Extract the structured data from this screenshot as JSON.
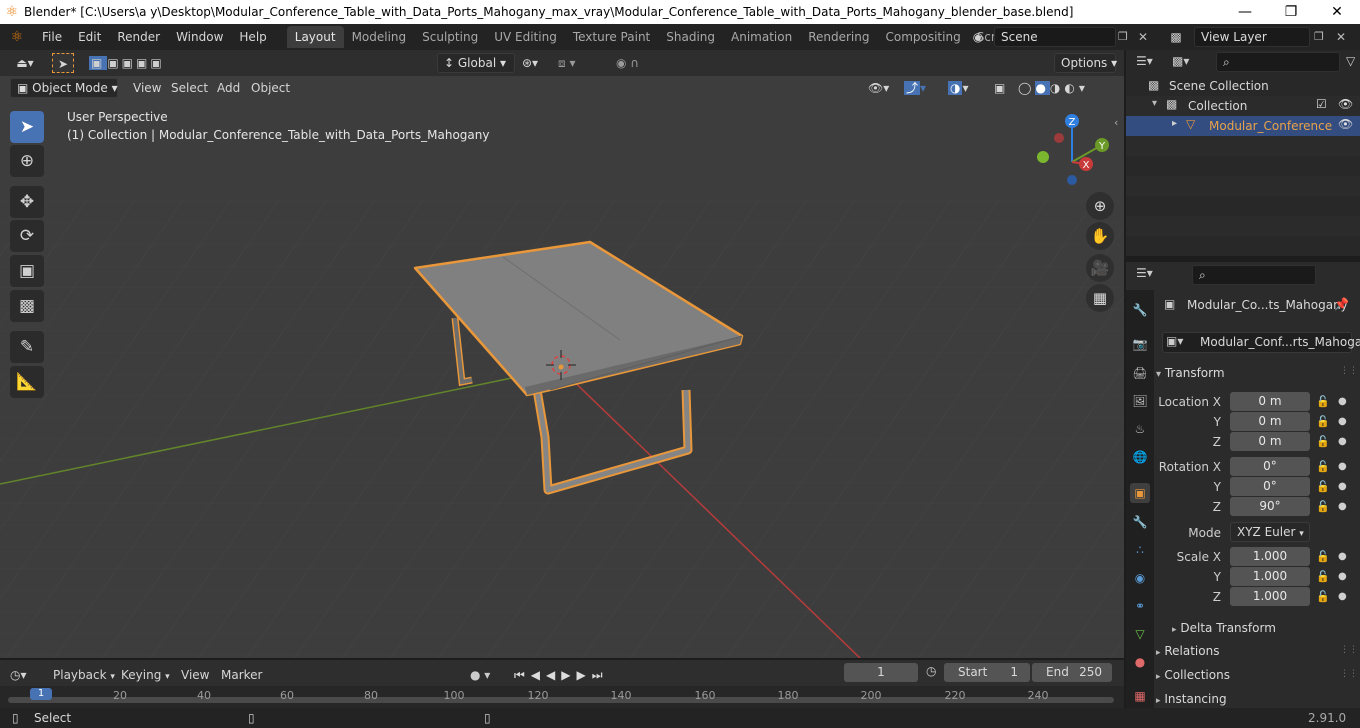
{
  "window": {
    "title": "Blender* [C:\\Users\\a y\\Desktop\\Modular_Conference_Table_with_Data_Ports_Mahogany_max_vray\\Modular_Conference_Table_with_Data_Ports_Mahogany_blender_base.blend]"
  },
  "menus": [
    "File",
    "Edit",
    "Render",
    "Window",
    "Help"
  ],
  "workspaces": [
    "Layout",
    "Modeling",
    "Sculpting",
    "UV Editing",
    "Texture Paint",
    "Shading",
    "Animation",
    "Rendering",
    "Compositing",
    "Scripting"
  ],
  "workspace_add": "+",
  "scene": {
    "label": "Scene"
  },
  "view_layer": {
    "label": "View Layer"
  },
  "viewport": {
    "orientation": "Global",
    "options_label": "Options",
    "mode": "Object Mode",
    "header_menus": [
      "View",
      "Select",
      "Add",
      "Object"
    ],
    "perspective_label": "User Perspective",
    "collection_info": "(1) Collection | Modular_Conference_Table_with_Data_Ports_Mahogany",
    "gizmo_axes": {
      "x": "X",
      "y": "Y",
      "z": "Z"
    }
  },
  "outliner": {
    "scene_collection": "Scene Collection",
    "collection": "Collection",
    "object": "Modular_Conference"
  },
  "properties": {
    "object_name": "Modular_Co...ts_Mahogany",
    "data_name": "Modular_Conf...rts_Mahogany",
    "transform_header": "Transform",
    "location_label": "Location X",
    "rotation_label": "Rotation X",
    "scale_label": "Scale X",
    "y_label": "Y",
    "z_label": "Z",
    "location": {
      "x": "0 m",
      "y": "0 m",
      "z": "0 m"
    },
    "rotation": {
      "x": "0°",
      "y": "0°",
      "z": "90°"
    },
    "mode_label": "Mode",
    "mode_value": "XYZ Euler",
    "scale": {
      "x": "1.000",
      "y": "1.000",
      "z": "1.000"
    },
    "delta_transform": "Delta Transform",
    "relations": "Relations",
    "collections": "Collections",
    "instancing": "Instancing"
  },
  "timeline": {
    "menus": [
      "Playback",
      "Keying",
      "View",
      "Marker"
    ],
    "current_frame": "1",
    "start_label": "Start",
    "start_value": "1",
    "end_label": "End",
    "end_value": "250",
    "ticks": [
      "1",
      "20",
      "40",
      "60",
      "80",
      "100",
      "120",
      "140",
      "160",
      "180",
      "200",
      "220",
      "240"
    ]
  },
  "status": {
    "select_label": "Select",
    "version": "2.91.0"
  },
  "colors": {
    "accent": "#4772b3",
    "selection_outline": "#e8973a",
    "x_axis": "#c93b3b",
    "y_axis": "#6c9a28",
    "z_axis": "#2f7fe0"
  }
}
